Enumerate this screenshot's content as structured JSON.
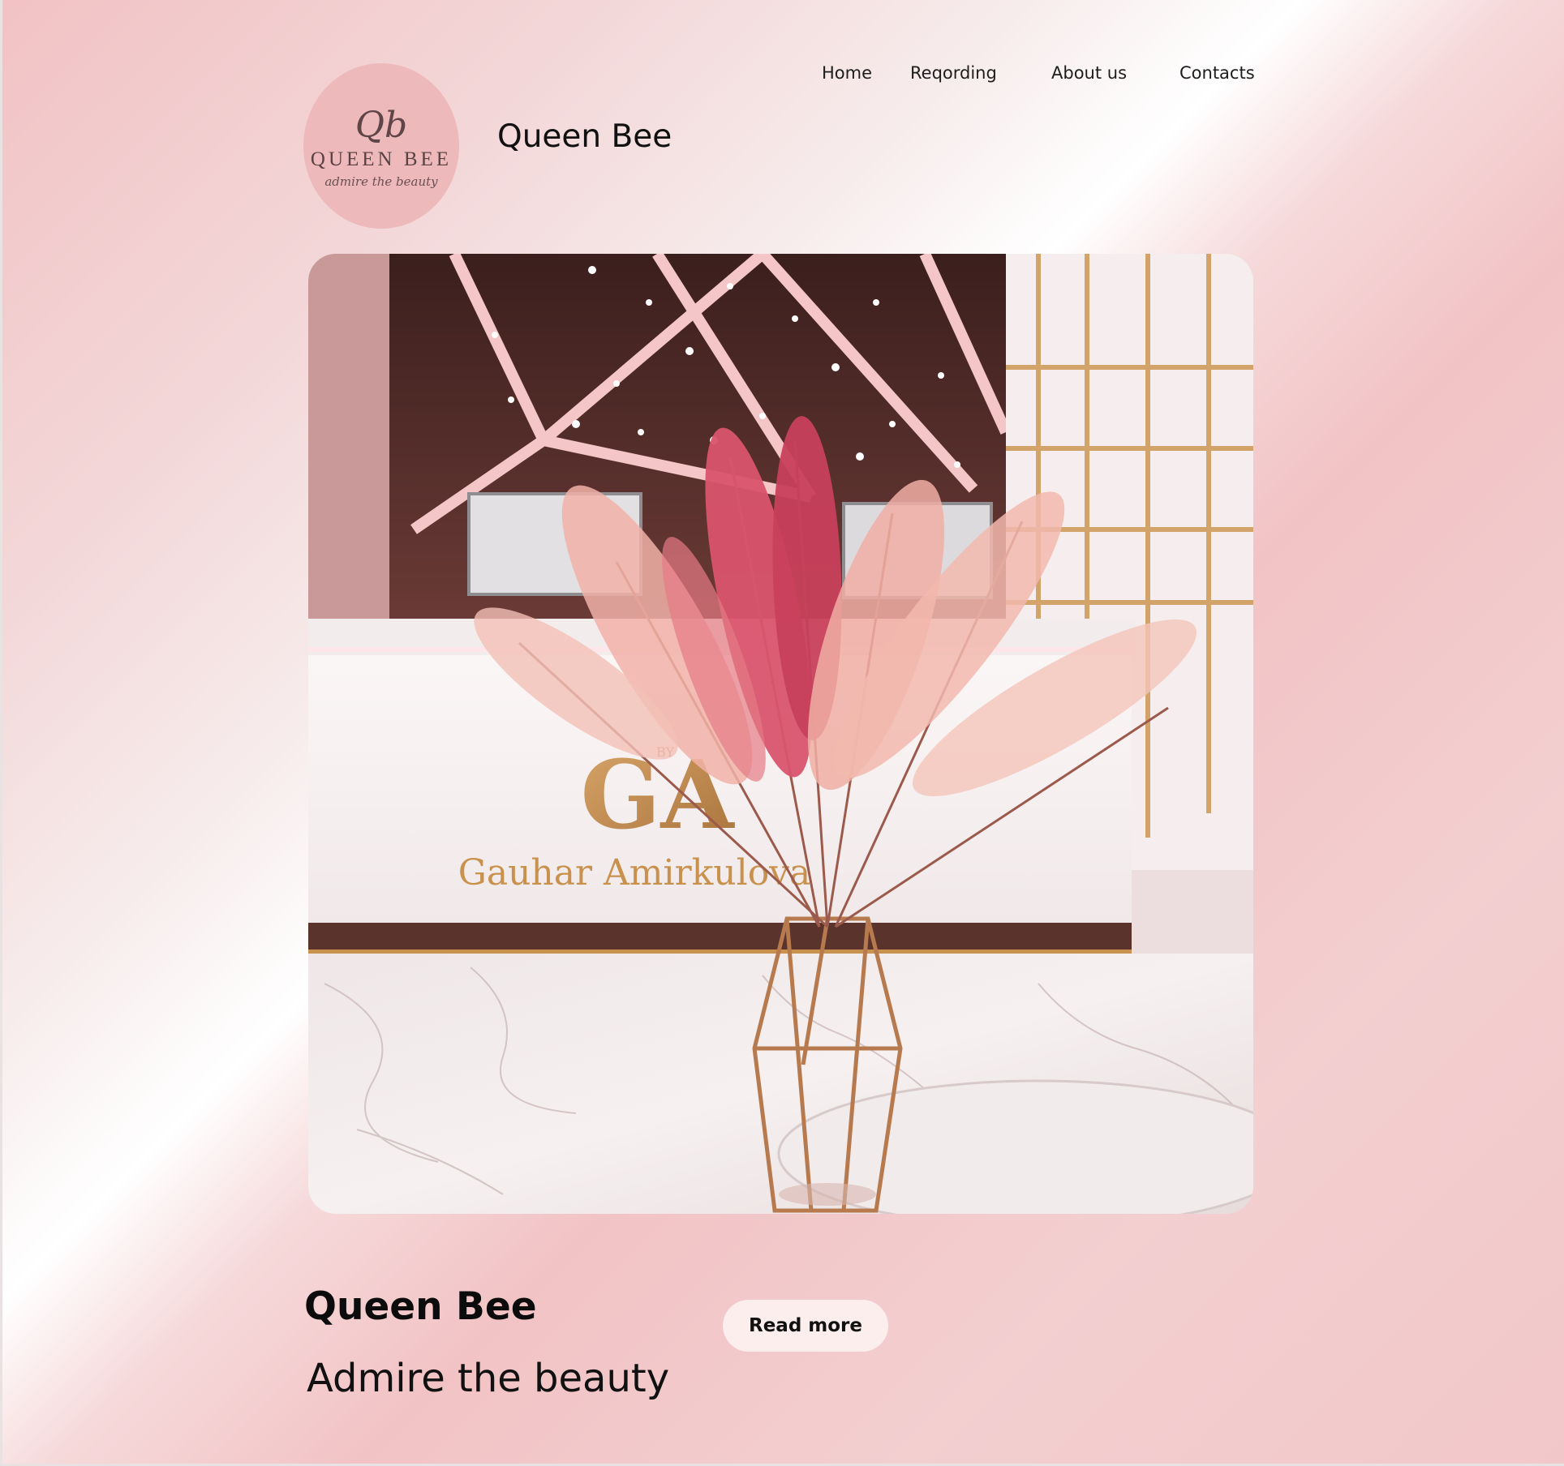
{
  "logo": {
    "monogram": "Qb",
    "wordmark": "QUEEN BEE",
    "tagline": "admire the beauty"
  },
  "header": {
    "title": "Queen Bee"
  },
  "nav": {
    "items": [
      {
        "label": "Home"
      },
      {
        "label": "Reqording"
      },
      {
        "label": "About us"
      },
      {
        "label": "Contacts"
      }
    ]
  },
  "hero": {
    "desk_brand": "Gauhar Amirkulova",
    "desk_monogram": "GA",
    "desk_monogram_small": "BY"
  },
  "main": {
    "heading": "Queen Bee",
    "subheading": "Admire the beauty",
    "read_more_label": "Read more"
  },
  "colors": {
    "accent_pink": "#f2c3c5",
    "button_bg": "#fdeeee",
    "gold": "#c8924e"
  }
}
